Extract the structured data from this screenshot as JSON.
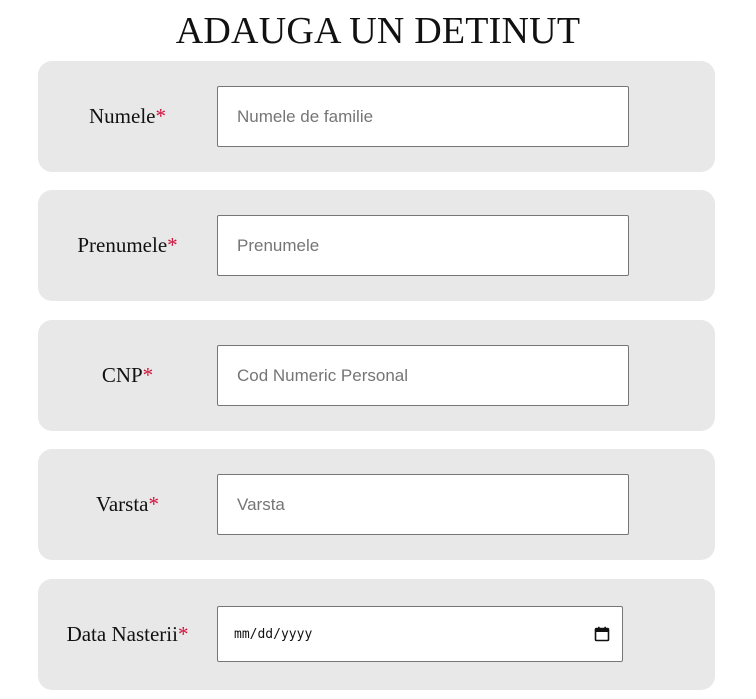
{
  "page": {
    "title": "ADAUGA UN DETINUT"
  },
  "form": {
    "required_marker": "*",
    "fields": [
      {
        "label": "Numele",
        "placeholder": "Numele de familie",
        "value": ""
      },
      {
        "label": "Prenumele",
        "placeholder": "Prenumele",
        "value": ""
      },
      {
        "label": "CNP",
        "placeholder": "Cod Numeric Personal",
        "value": ""
      },
      {
        "label": "Varsta",
        "placeholder": "Varsta",
        "value": ""
      },
      {
        "label": "Data Nasterii",
        "date_format": "mm/dd/yyyy",
        "icon": "calendar-icon"
      }
    ]
  },
  "colors": {
    "row_background": "#e8e8e8",
    "required_marker": "#d0103a",
    "input_border": "#767676",
    "placeholder": "#757575"
  }
}
